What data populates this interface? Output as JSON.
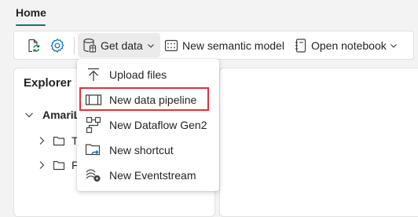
{
  "tabs": {
    "home": "Home"
  },
  "toolbar": {
    "get_data": "Get data",
    "new_semantic_model": "New semantic model",
    "open_notebook": "Open notebook"
  },
  "explorer": {
    "title": "Explorer",
    "workspace": "AmariL",
    "children": [
      "T",
      "F"
    ]
  },
  "get_data_menu": {
    "items": [
      {
        "label": "Upload files",
        "icon": "upload-icon"
      },
      {
        "label": "New data pipeline",
        "icon": "pipeline-icon",
        "highlighted": true
      },
      {
        "label": "New Dataflow Gen2",
        "icon": "dataflow-icon"
      },
      {
        "label": "New shortcut",
        "icon": "shortcut-icon"
      },
      {
        "label": "New Eventstream",
        "icon": "eventstream-icon"
      }
    ]
  },
  "colors": {
    "accent": "#117865",
    "highlight_border": "#e0323a",
    "icon_blue": "#0f6cbd",
    "icon_green": "#107c41"
  }
}
